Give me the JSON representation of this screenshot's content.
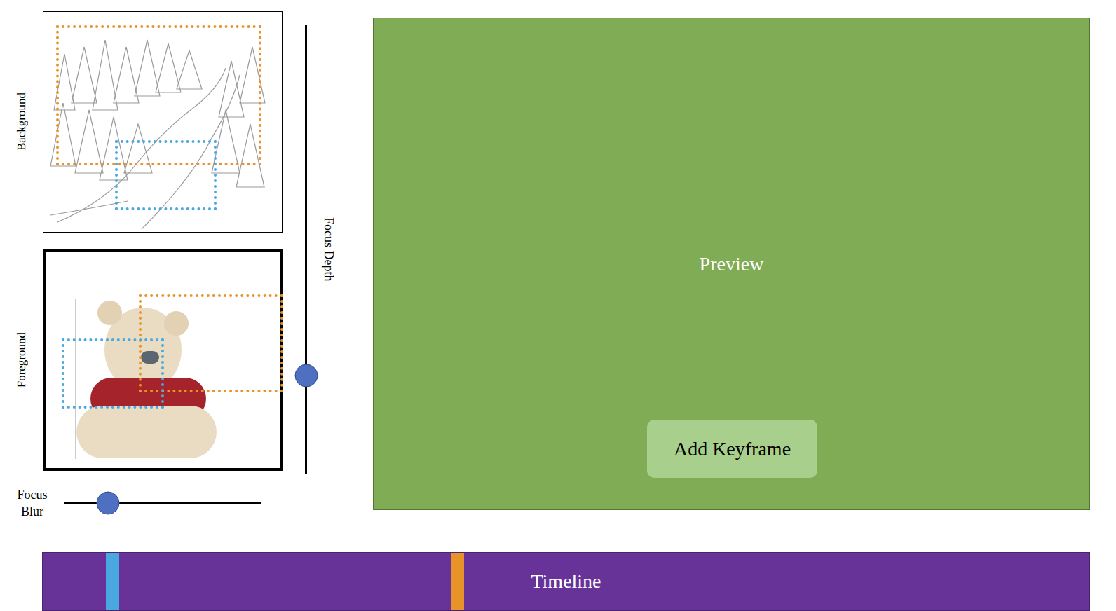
{
  "panels": [
    {
      "label": "Background"
    },
    {
      "label": "Foreground"
    }
  ],
  "sliders": [
    {
      "label": "Focus Depth",
      "level": 0.22
    },
    {
      "label": "Focus Blur",
      "level": 0.22
    }
  ],
  "preview": {
    "label": "Preview",
    "button": "Add Keyframe"
  },
  "timeline": {
    "label": "Timeline",
    "keyframes": [
      {
        "time": 0.06,
        "color": "#4aa8e0"
      },
      {
        "time": 0.39,
        "color": "#e8932a"
      }
    ]
  }
}
